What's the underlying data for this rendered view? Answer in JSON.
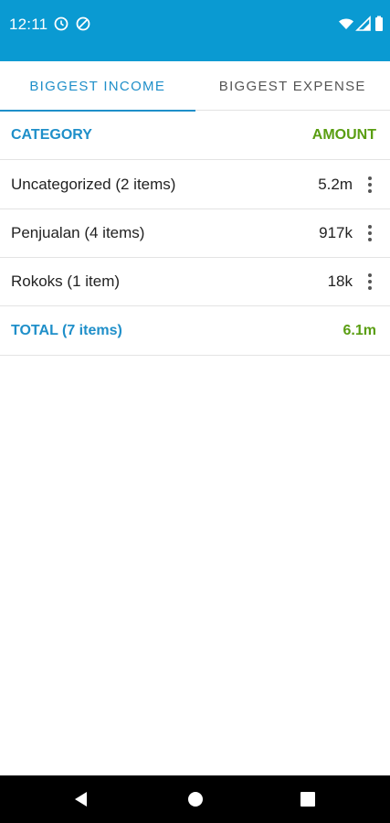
{
  "status_bar": {
    "time": "12:11",
    "color": "#0a9ad2"
  },
  "tabs": [
    {
      "label": "BIGGEST INCOME",
      "active": true
    },
    {
      "label": "BIGGEST EXPENSE",
      "active": false
    }
  ],
  "table": {
    "header": {
      "category": "CATEGORY",
      "amount": "AMOUNT"
    },
    "rows": [
      {
        "category": "Uncategorized (2 items)",
        "amount": "5.2m"
      },
      {
        "category": "Penjualan (4 items)",
        "amount": "917k"
      },
      {
        "category": "Rokoks (1 item)",
        "amount": "18k"
      }
    ],
    "total": {
      "category": "TOTAL (7 items)",
      "amount": "6.1m"
    }
  },
  "colors": {
    "accent": "#1f8fc9",
    "amount_green": "#5a9e12"
  }
}
